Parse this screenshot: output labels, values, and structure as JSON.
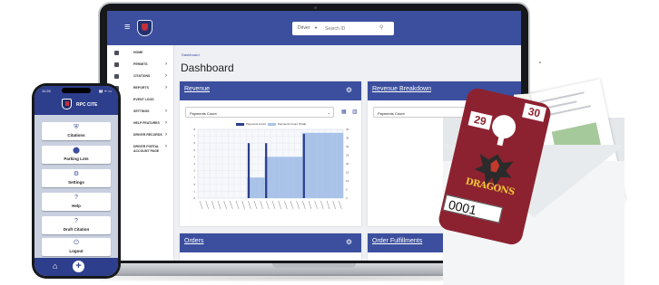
{
  "laptop": {
    "search": {
      "scope": "Driver",
      "placeholder": "Search ID"
    },
    "sidebar": [
      {
        "label": "HOME",
        "chevron": ""
      },
      {
        "label": "PERMITS",
        "chevron": "›"
      },
      {
        "label": "CITATIONS",
        "chevron": "›"
      },
      {
        "label": "REPORTS",
        "chevron": "›"
      },
      {
        "label": "EVENT LOGS",
        "chevron": ""
      },
      {
        "label": "SETTINGS",
        "chevron": "›"
      },
      {
        "label": "HELP FEATURES",
        "chevron": "›"
      },
      {
        "label": "DRIVER RECORDS",
        "chevron": "›"
      },
      {
        "label": "DRIVER PORTAL",
        "label2": "ACCOUNT PAGE",
        "chevron": "›"
      }
    ],
    "breadcrumb": "Dashboard",
    "page_title": "Dashboard",
    "cards": {
      "revenue": {
        "title": "Revenue",
        "select": "Payments Count"
      },
      "revenue_breakdown": {
        "title": "Revenue Breakdown",
        "select": "Payments Count"
      },
      "orders": {
        "title": "Orders"
      },
      "order_fulfillments": {
        "title": "Order Fulfillments"
      }
    }
  },
  "chart_data": {
    "type": "bar",
    "series": [
      {
        "name": "Payments Count",
        "color": "#2b3d8c",
        "values": [
          0,
          0,
          0,
          0,
          0,
          0,
          0,
          0,
          0,
          0,
          0,
          0,
          0,
          0,
          0,
          0,
          0,
          12,
          0,
          0,
          0,
          0,
          0,
          12,
          0,
          0,
          0,
          0,
          0,
          0,
          0,
          0,
          0,
          0,
          0,
          0,
          14,
          0,
          0,
          0,
          0,
          0,
          0,
          0,
          0,
          0,
          0,
          0,
          0,
          0
        ]
      },
      {
        "name": "Payments Count (Total)",
        "color": "#a9c3e8",
        "values": [
          0,
          0,
          0,
          0,
          0,
          0,
          0,
          0,
          0,
          0,
          0,
          0,
          0,
          0,
          0,
          0,
          0,
          12,
          12,
          12,
          12,
          12,
          12,
          24,
          24,
          24,
          24,
          24,
          24,
          24,
          24,
          24,
          24,
          24,
          24,
          24,
          38,
          38,
          38,
          38,
          38,
          38,
          38,
          38,
          38,
          38,
          38,
          38,
          38,
          38
        ]
      }
    ],
    "y_left_ticks": [
      "8",
      "7",
      "6",
      "5",
      "4",
      "3",
      "2",
      "1",
      "0",
      "-1",
      "-2"
    ],
    "y_right_ticks": [
      "40",
      "35",
      "30",
      "25",
      "20",
      "15",
      "10",
      "5",
      "0"
    ],
    "grid": true,
    "legend": "top"
  },
  "phone": {
    "time": "11:26",
    "status": "▮▮ ᯤ ▭",
    "app_name": "RPC CITE",
    "buttons": [
      {
        "label": "Citations",
        "icon": "shield-icon",
        "glyph": "⛨"
      },
      {
        "label": "Parking Lots",
        "icon": "map-pin-icon",
        "glyph": "⬤"
      },
      {
        "label": "Settings",
        "icon": "gear-icon",
        "glyph": "⚙"
      },
      {
        "label": "Help",
        "icon": "help-icon",
        "glyph": "?"
      },
      {
        "label": "Draft Citation",
        "icon": "draft-icon",
        "glyph": "?"
      },
      {
        "label": "Logout",
        "icon": "power-icon",
        "glyph": "⏻"
      }
    ],
    "nav": {
      "home_glyph": "⌂",
      "add_glyph": "+"
    }
  },
  "hangtag": {
    "left_number": "29",
    "right_number": "30",
    "brand": "DRAGONS",
    "serial": "0001"
  },
  "colors": {
    "brand": "#3c4f9e",
    "phone_brand": "#2d3e8c",
    "tag": "#8c2230",
    "tag_gold": "#f0c43a"
  }
}
